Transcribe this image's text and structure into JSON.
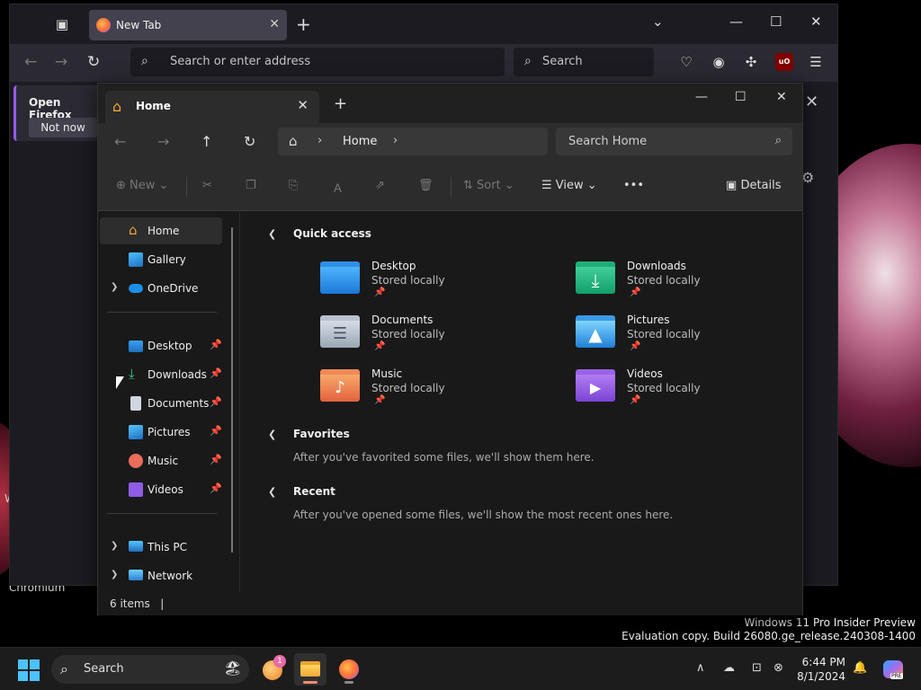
{
  "desktop": {
    "watermark_line1": "Windows 11 Pro Insider Preview",
    "watermark_line2": "Evaluation copy. Build 26080.ge_release.240308-1400",
    "chromium_label": "Chromium",
    "edge_w": "W"
  },
  "firefox": {
    "tab_title": "New Tab",
    "url_placeholder": "Search or enter address",
    "search_placeholder": "Search",
    "ublock_badge": "uO",
    "banner_title": "Open Firefox",
    "banner_button": "Not now"
  },
  "explorer": {
    "tab_title": "Home",
    "breadcrumb": "Home",
    "search_placeholder": "Search Home",
    "toolbar": {
      "new_label": "New",
      "sort_label": "Sort",
      "view_label": "View",
      "more_label": "•••",
      "details_label": "Details"
    },
    "nav": {
      "home": "Home",
      "gallery": "Gallery",
      "onedrive": "OneDrive",
      "pinned": [
        {
          "label": "Desktop"
        },
        {
          "label": "Downloads"
        },
        {
          "label": "Documents"
        },
        {
          "label": "Pictures"
        },
        {
          "label": "Music"
        },
        {
          "label": "Videos"
        }
      ],
      "this_pc": "This PC",
      "network": "Network"
    },
    "quick_access": {
      "title": "Quick access",
      "items": [
        {
          "name": "Desktop",
          "sub": "Stored locally"
        },
        {
          "name": "Downloads",
          "sub": "Stored locally"
        },
        {
          "name": "Documents",
          "sub": "Stored locally"
        },
        {
          "name": "Pictures",
          "sub": "Stored locally"
        },
        {
          "name": "Music",
          "sub": "Stored locally"
        },
        {
          "name": "Videos",
          "sub": "Stored locally"
        }
      ]
    },
    "favorites": {
      "title": "Favorites",
      "empty": "After you've favorited some files, we'll show them here."
    },
    "recent": {
      "title": "Recent",
      "empty": "After you've opened some files, we'll show the most recent ones here."
    },
    "status": "6 items"
  },
  "taskbar": {
    "search_placeholder": "Search",
    "notify_badge": "1",
    "time": "6:44 PM",
    "date": "8/1/2024",
    "copilot_badge": "PRE"
  },
  "colors": {
    "accent": "#4cc2ff",
    "folder_yellow": "#f2a73b",
    "firefox_purple": "#9b59ff"
  }
}
